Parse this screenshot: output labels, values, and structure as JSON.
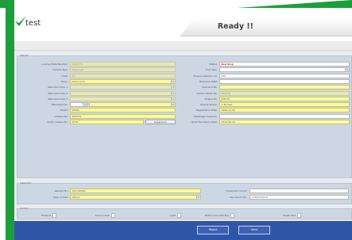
{
  "app": {
    "logo_text": "test",
    "status_title": "Ready !!"
  },
  "vehicle": {
    "legend": "Vehicle",
    "left_fields": [
      {
        "label": "License Plate Number",
        "value": "3000774",
        "state": "disabled"
      },
      {
        "label": "Vehicle Type",
        "value": "Passenger",
        "state": "disabled"
      },
      {
        "label": "Class",
        "value": "M1",
        "state": "disabled"
      },
      {
        "label": "Body",
        "value": "Motorcycle",
        "state": "dropdown"
      },
      {
        "label": "Attached Code 1",
        "value": "",
        "state": "dropdown-disabled"
      },
      {
        "label": "Attached Code 2",
        "value": "",
        "state": "dropdown-disabled"
      },
      {
        "label": "Attached Code 3",
        "value": "",
        "state": "dropdown-disabled"
      },
      {
        "label": "Manufacturer",
        "value": "",
        "state": "dropdown-split"
      },
      {
        "label": "Model",
        "value": "VESPA",
        "state": "normal"
      },
      {
        "label": "Chassis No",
        "value": "000078",
        "state": "normal"
      },
      {
        "label": "Verify Chassis No",
        "value": "0078",
        "state": "with-button"
      }
    ],
    "supervisor_button": "Supervisor",
    "right_fields": [
      {
        "label": "Status",
        "value": "Red Stop",
        "state": "status"
      },
      {
        "label": "Fuel Type",
        "value": "",
        "state": "dropdown-white"
      },
      {
        "label": "Engine Capacity CC",
        "value": "150",
        "state": "white"
      },
      {
        "label": "Maximum RPM",
        "value": "",
        "state": "white"
      },
      {
        "label": "Vehicle G.No",
        "value": "",
        "state": "normal"
      },
      {
        "label": "Vehicle Model No",
        "value": "000078",
        "state": "disabled"
      },
      {
        "label": "Engine No",
        "value": "JH5070",
        "state": "normal"
      },
      {
        "label": "Engine Stroke",
        "value": "4 Strokes",
        "state": "normal"
      },
      {
        "label": "Registration Date",
        "value": "1969-12-06",
        "state": "normal"
      },
      {
        "label": "Passenger Capacity",
        "value": "",
        "state": "white"
      },
      {
        "label": "Road Tax Expiry Date",
        "value": "2010-06-24",
        "state": "normal"
      }
    ]
  },
  "inspection": {
    "legend": "Inspection",
    "receipt_label": "Receipt No",
    "receipt_value": "100726064",
    "type_label": "Type of Insp",
    "type_value": "Others",
    "counter_label": "Inspection Count",
    "counter_value": "",
    "keypunch_label": "Key Punch No",
    "keypunch_value": "C33005164-E"
  },
  "control": {
    "legend": "Control",
    "checks": [
      "Exhaust",
      "Sound Level",
      "Light",
      "Motorcycle Side Slip",
      "Break Test"
    ]
  },
  "buttons": {
    "reject": "Reject",
    "send": "Send"
  }
}
